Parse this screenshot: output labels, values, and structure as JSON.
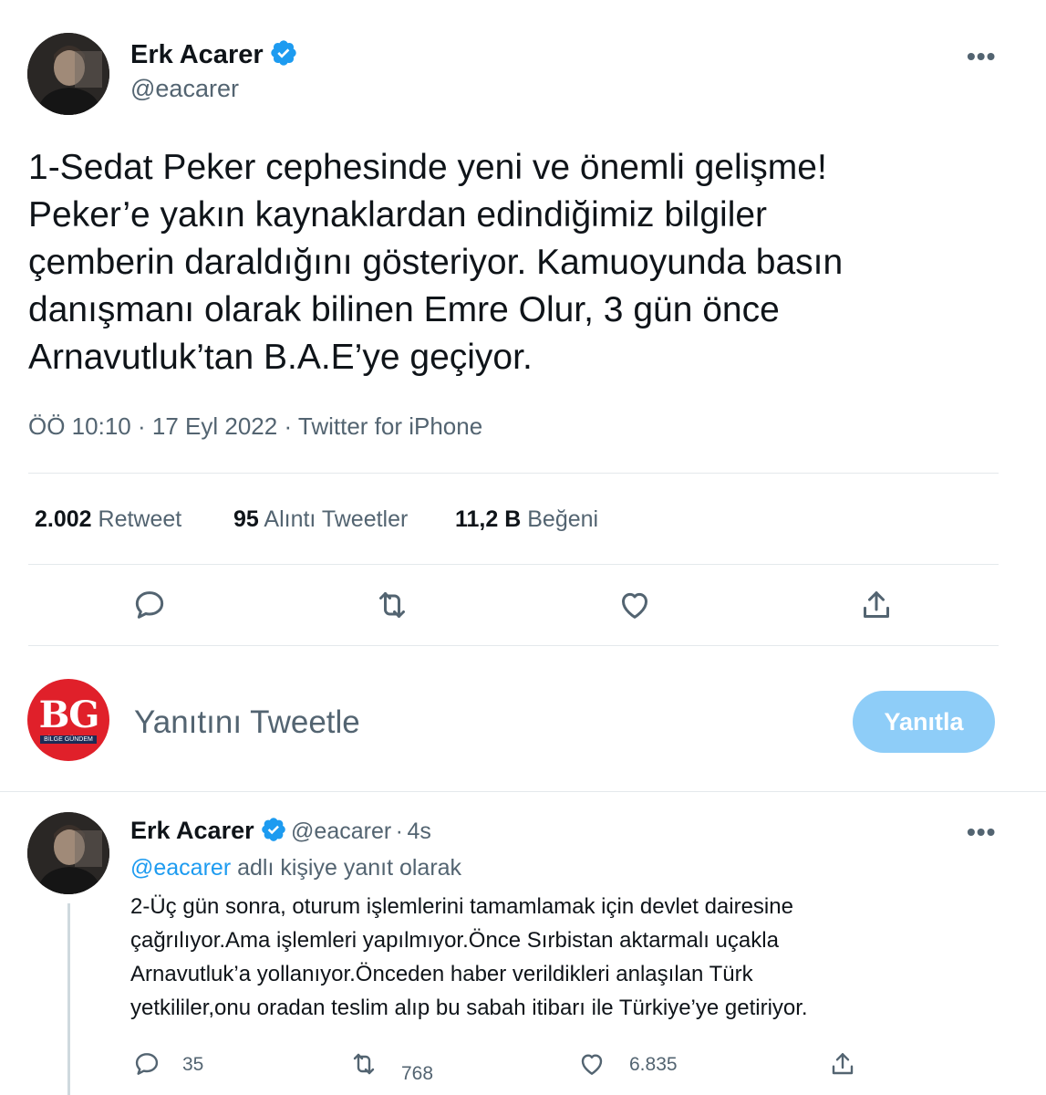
{
  "main_tweet": {
    "author_name": "Erk Acarer",
    "handle": "@eacarer",
    "more_label": "•••",
    "text": "1-Sedat Peker cephesinde yeni ve önemli gelişme! Peker’e yakın kaynaklardan edindiğimiz bilgiler çemberin daraldığını gösteriyor. Kamuoyunda basın danışmanı olarak bilinen Emre Olur, 3 gün önce Arnavutluk’tan B.A.E’ye geçiyor.",
    "text_lines": [
      "1-Sedat Peker cephesinde yeni ve önemli gelişme!",
      "Peker’e yakın kaynaklardan edindiğimiz bilgiler",
      "çemberin daraldığını gösteriyor. Kamuoyunda basın",
      "danışmanı olarak bilinen Emre Olur, 3 gün önce",
      "Arnavutluk’tan B.A.E’ye geçiyor."
    ],
    "time": "ÖÖ 10:10",
    "date": "17 Eyl 2022",
    "source": "Twitter for iPhone",
    "separator": "·",
    "stats": {
      "retweets_value": "2.002",
      "retweets_label": "Retweet",
      "quotes_value": "95",
      "quotes_label": "Alıntı Tweetler",
      "likes_value": "11,2 B",
      "likes_label": "Beğeni"
    },
    "actions": [
      "reply-icon",
      "retweet-icon",
      "like-icon",
      "share-icon"
    ]
  },
  "composer": {
    "avatar_letters": "BG",
    "avatar_subtext": "BİLGE GÜNDEM",
    "placeholder": "Yanıtını Tweetle",
    "button_label": "Yanıtla"
  },
  "reply_tweet": {
    "author_name": "Erk Acarer",
    "handle": "@eacarer",
    "separator": "·",
    "age": "4s",
    "more_label": "•••",
    "replying_to_handle": "@eacarer",
    "replying_to_text": "adlı kişiye yanıt olarak",
    "text_lines": [
      "2-Üç gün sonra, oturum işlemlerini tamamlamak için devlet dairesine",
      "çağrılıyor.Ama işlemleri yapılmıyor.Önce Sırbistan aktarmalı uçakla",
      "Arnavutluk’a yollanıyor.Önceden haber verildikleri anlaşılan Türk",
      "yetkililer,onu oradan teslim alıp bu sabah itibarı ile Türkiye’ye getiriyor."
    ],
    "counts": {
      "replies": "35",
      "retweets": "768",
      "likes": "6.835"
    }
  },
  "colors": {
    "accent": "#1d9bf0",
    "reply_button_disabled": "#8ecdf8",
    "secondary_text": "#536471",
    "logo_red": "#e0202a"
  }
}
